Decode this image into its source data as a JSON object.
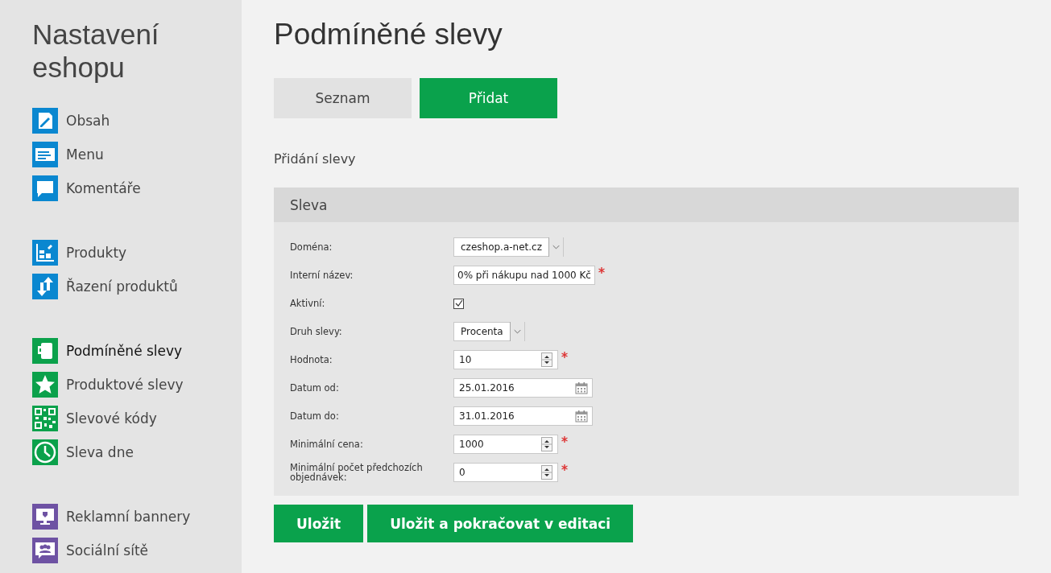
{
  "sidebar": {
    "title": "Nastavení eshopu",
    "groups": [
      {
        "items": [
          {
            "label": "Obsah",
            "kind": "edit",
            "color": "#0a87d0",
            "selected": false
          },
          {
            "label": "Menu",
            "kind": "lines",
            "color": "#0a87d0",
            "selected": false
          },
          {
            "label": "Komentáře",
            "kind": "bubble",
            "color": "#0a87d0",
            "selected": false
          }
        ]
      },
      {
        "items": [
          {
            "label": "Produkty",
            "kind": "boxes",
            "color": "#0a87d0",
            "selected": false
          },
          {
            "label": "Řazení produktů",
            "kind": "sort",
            "color": "#0a87d0",
            "selected": false
          }
        ]
      },
      {
        "items": [
          {
            "label": "Podmíněné slevy",
            "kind": "cup",
            "color": "#0ba14b",
            "selected": true
          },
          {
            "label": "Produktové slevy",
            "kind": "star",
            "color": "#0ba14b",
            "selected": false
          },
          {
            "label": "Slevové kódy",
            "kind": "qr",
            "color": "#0ba14b",
            "selected": false
          },
          {
            "label": "Sleva dne",
            "kind": "clock",
            "color": "#0ba14b",
            "selected": false
          }
        ]
      },
      {
        "items": [
          {
            "label": "Reklamní bannery",
            "kind": "monitor",
            "color": "#6e52a3",
            "selected": false
          },
          {
            "label": "Sociální sítě",
            "kind": "people",
            "color": "#6e52a3",
            "selected": false
          }
        ]
      }
    ]
  },
  "page_title": "Podmíněné slevy",
  "tabs": [
    {
      "label": "Seznam",
      "selected": false
    },
    {
      "label": "Přidat",
      "selected": true
    }
  ],
  "section_title": "Přidání slevy",
  "panel": {
    "title": "Sleva",
    "fields": [
      {
        "label": "Doména:",
        "kind": "select",
        "value": "czeshop.a-net.cz",
        "required": false
      },
      {
        "label": "Interní název:",
        "kind": "text",
        "value": "0% při nákupu nad 1000 Kč",
        "required": true
      },
      {
        "label": "Aktivní:",
        "kind": "checkbox",
        "checked": true,
        "required": false
      },
      {
        "label": "Druh slevy:",
        "kind": "select",
        "value": "Procenta",
        "required": false
      },
      {
        "label": "Hodnota:",
        "kind": "number",
        "value": "10",
        "required": true
      },
      {
        "label": "Datum od:",
        "kind": "date",
        "value": "25.01.2016",
        "required": false
      },
      {
        "label": "Datum do:",
        "kind": "date",
        "value": "31.01.2016",
        "required": false
      },
      {
        "label": "Minimální cena:",
        "kind": "number",
        "value": "1000",
        "required": true
      },
      {
        "label": "Minimální počet předchozích objednávek:",
        "kind": "number",
        "value": "0",
        "required": true
      }
    ]
  },
  "buttons": [
    "Uložit",
    "Uložit a pokračovat v editaci"
  ]
}
